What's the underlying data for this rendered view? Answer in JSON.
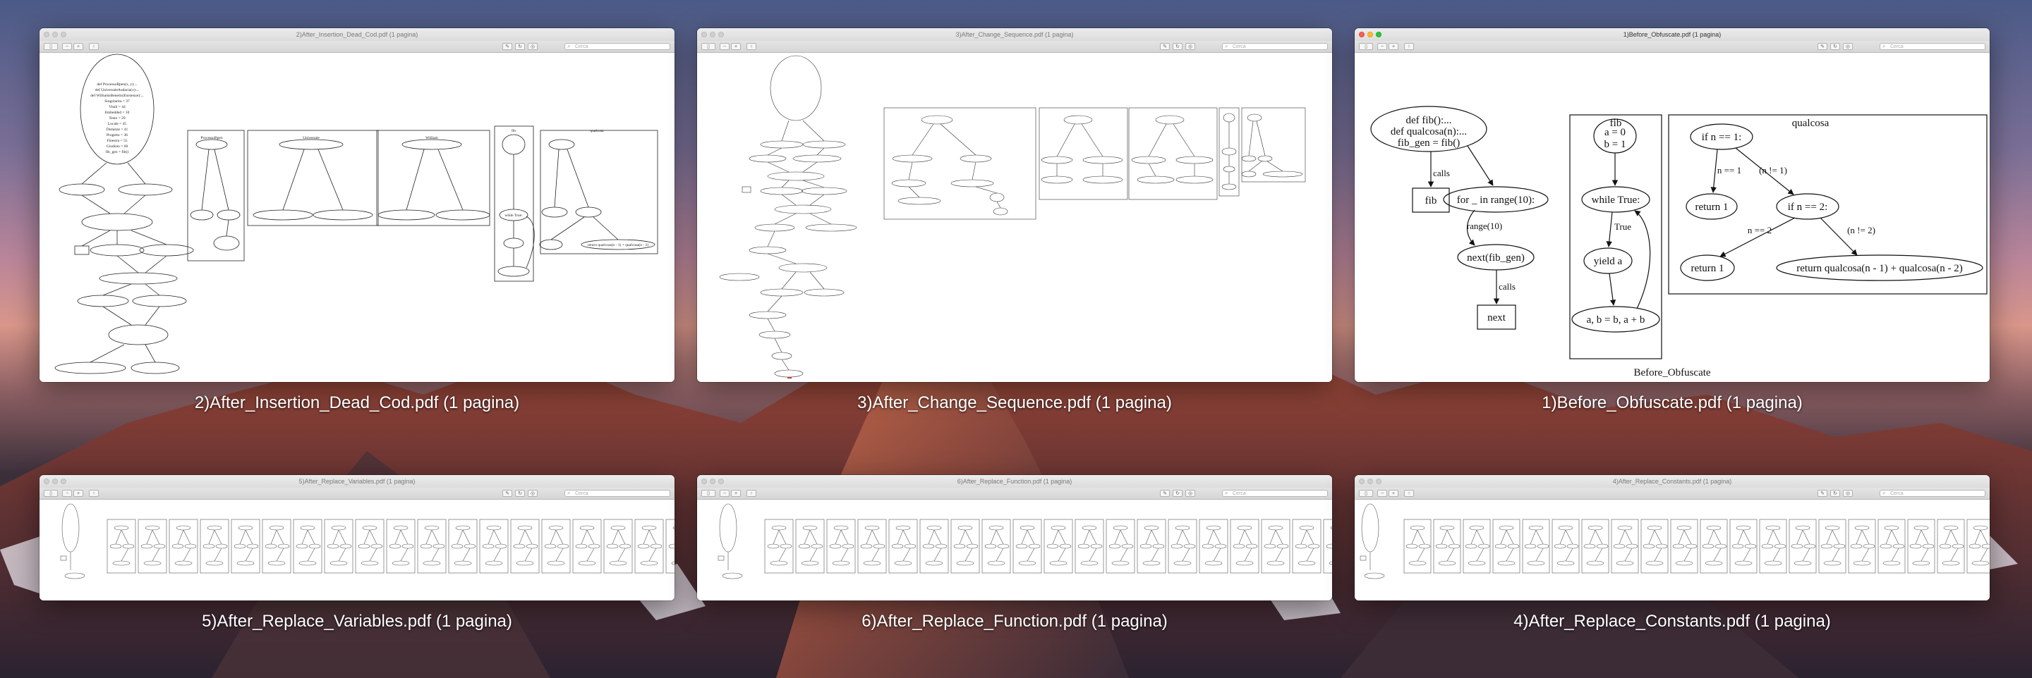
{
  "desktop": {
    "search_placeholder": "Cerca",
    "windows": [
      {
        "id": "w2",
        "title": "2)After_Insertion_Dead_Cod.pdf (1 pagina)",
        "caption": "2)After_Insertion_Dead_Cod.pdf (1 pagina)"
      },
      {
        "id": "w3",
        "title": "3)After_Change_Sequence.pdf (1 pagina)",
        "caption": "3)After_Change_Sequence.pdf (1 pagina)"
      },
      {
        "id": "w1",
        "title": "1)Before_Obfuscate.pdf (1 pagina)",
        "caption": "1)Before_Obfuscate.pdf (1 pagina)"
      },
      {
        "id": "w5",
        "title": "5)After_Replace_Variables.pdf (1 pagina)",
        "caption": "5)After_Replace_Variables.pdf (1 pagina)"
      },
      {
        "id": "w6",
        "title": "6)After_Replace_Function.pdf (1 pagina)",
        "caption": "6)After_Replace_Function.pdf (1 pagina)"
      },
      {
        "id": "w4",
        "title": "4)After_Replace_Constants.pdf (1 pagina)",
        "caption": "4)After_Replace_Constants.pdf (1 pagina)"
      }
    ]
  },
  "graph_before": {
    "root_node": "def fib():...\ndef qualcosa(n):...\nfib_gen = fib()",
    "calls_label": "calls",
    "fib_node": "fib",
    "for_node": "for _ in range(10):",
    "range_label": "range(10)",
    "next_fib_node": "next(fib_gen)",
    "calls_label2": "calls",
    "next_node": "next",
    "cluster_fib": "fib",
    "ab_node_1": "a = 0",
    "ab_node_2": "b = 1",
    "while_node": "while True:",
    "true_label": "True",
    "yield_node": "yield a",
    "assign_node": "a, b = b, a + b",
    "cluster_qualcosa": "qualcosa",
    "if_n1": "if n == 1:",
    "edge_n_eq_1": "n == 1",
    "edge_n_ne_1": "(n != 1)",
    "return1a": "return 1",
    "if_n2": "if n == 2:",
    "edge_n_eq_2": "n == 2",
    "edge_n_ne_2": "(n != 2)",
    "return1b": "return 1",
    "return_rec": "return qualcosa(n - 1) + qualcosa(n - 2)",
    "graph_label": "Before_Obfuscate"
  },
  "graph_dead": {
    "root": "def ProcessoBpen(x, y):...\ndef UniversaleAudacia(x):...\ndef WilliamsBeneito(Esistenze):...\nSingolarita = 37\nVitali = 44\nEmbedded = 10\nTesto = 29\nLocale = 45\nDistanze = 41\nProgetto = 36\nSpoil = 4\nDiventato = 66\nFinestra = 55\nGiudizio = 60\nRomeo = 18\nMonitorato = 16\nEnigma = 31\nfib_gen = fib()\nif Scompetto > Embedded:",
    "c1": "ProcessoBpen",
    "c2": "Universale",
    "c3": "William",
    "c4": "fib",
    "c5": "qualcosa"
  }
}
